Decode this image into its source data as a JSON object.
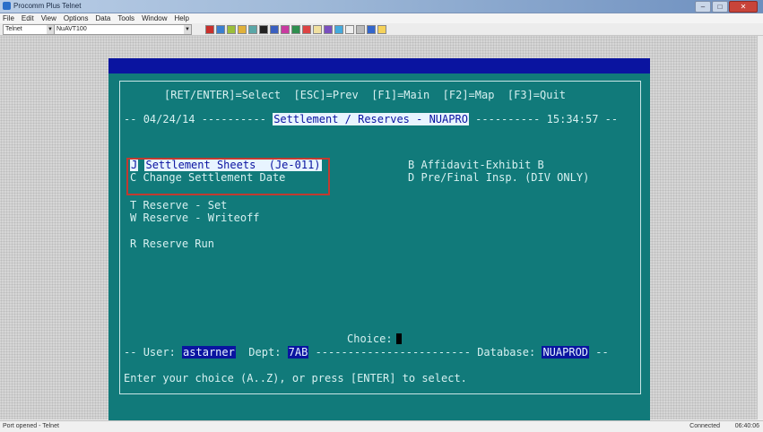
{
  "window": {
    "title": "Procomm Plus Telnet"
  },
  "menu": [
    "File",
    "Edit",
    "View",
    "Options",
    "Data",
    "Tools",
    "Window",
    "Help"
  ],
  "toolbar": {
    "connection_type": "Telnet",
    "terminal": "NuAVT100"
  },
  "terminal": {
    "function_keys": "[RET/ENTER]=Select  [ESC]=Prev  [F1]=Main  [F2]=Map  [F3]=Quit",
    "date": "04/24/14",
    "screen_title": "Settlement / Reserves - NUAPRO",
    "time": "15:34:57",
    "options": {
      "j": {
        "key": "J",
        "label": "Settlement Sheets  (Je-011)"
      },
      "c": {
        "key": "C",
        "label": "Change Settlement Date"
      },
      "t": {
        "key": "T",
        "label": "Reserve - Set"
      },
      "w": {
        "key": "W",
        "label": "Reserve - Writeoff"
      },
      "r": {
        "key": "R",
        "label": "Reserve Run"
      },
      "b": {
        "key": "B",
        "label": "Affidavit-Exhibit B"
      },
      "d": {
        "key": "D",
        "label": "Pre/Final Insp. (DIV ONLY)"
      }
    },
    "choice_label": "Choice:",
    "user_label": "User:",
    "user": "astarner",
    "dept_label": "Dept:",
    "dept": "7AB",
    "database_label": "Database:",
    "database": "NUAPROD",
    "prompt": "Enter your choice (A..Z), or press [ENTER] to select."
  },
  "status": {
    "left": "Port opened - Telnet",
    "right": "Connected",
    "time": "06:40:06"
  },
  "colors": {
    "terminal_bg": "#117a7a",
    "terminal_text": "#d6f0f0",
    "highlight_bg": "#0a14a0",
    "annotation": "#c23a30"
  }
}
